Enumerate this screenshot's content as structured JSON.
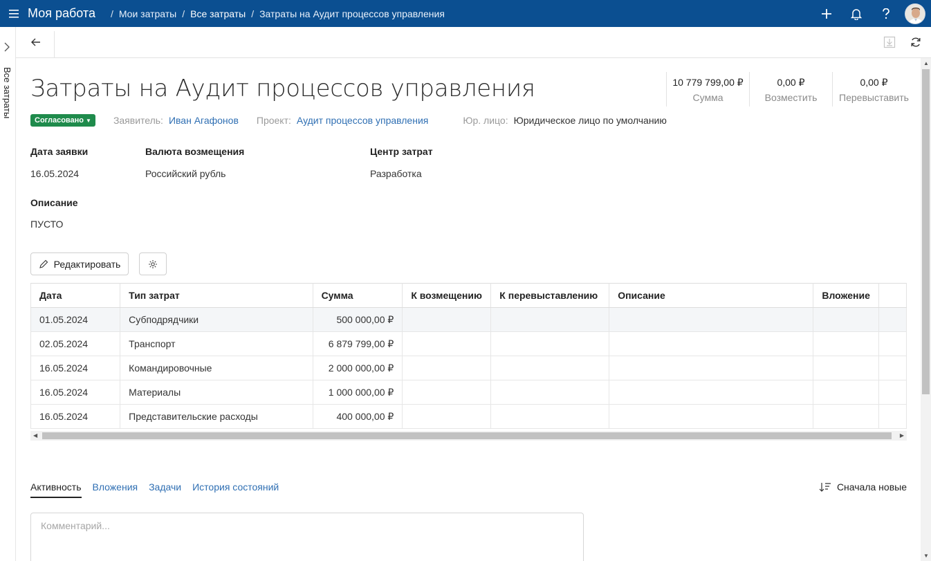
{
  "header": {
    "app_title": "Моя работа",
    "breadcrumbs": [
      {
        "label": "Мои затраты"
      },
      {
        "label": "Все затраты"
      },
      {
        "label": "Затраты на Аудит процессов управления"
      }
    ],
    "separator": "/"
  },
  "rail": {
    "label": "Все затраты"
  },
  "page": {
    "title": "Затраты на Аудит процессов управления",
    "status": "Согласовано",
    "summary": [
      {
        "value": "10 779 799,00 ₽",
        "label": "Сумма"
      },
      {
        "value": "0,00 ₽",
        "label": "Возместить"
      },
      {
        "value": "0,00 ₽",
        "label": "Перевыставить"
      }
    ],
    "meta": {
      "applicant_label": "Заявитель:",
      "applicant": "Иван Агафонов",
      "project_label": "Проект:",
      "project": "Аудит процессов управления",
      "entity_label": "Юр. лицо:",
      "entity": "Юридическое лицо по умолчанию"
    },
    "fields": {
      "date_label": "Дата заявки",
      "date_value": "16.05.2024",
      "currency_label": "Валюта возмещения",
      "currency_value": "Российский рубль",
      "cost_center_label": "Центр затрат",
      "cost_center_value": "Разработка",
      "description_label": "Описание",
      "description_value": "ПУСТО"
    },
    "edit_button": "Редактировать"
  },
  "table": {
    "columns": [
      "Дата",
      "Тип затрат",
      "Сумма",
      "К возмещению",
      "К перевыставлению",
      "Описание",
      "Вложение"
    ],
    "rows": [
      {
        "date": "01.05.2024",
        "type": "Субподрядчики",
        "amount": "500 000,00 ₽"
      },
      {
        "date": "02.05.2024",
        "type": "Транспорт",
        "amount": "6 879 799,00 ₽"
      },
      {
        "date": "16.05.2024",
        "type": "Командировочные",
        "amount": "2 000 000,00 ₽"
      },
      {
        "date": "16.05.2024",
        "type": "Материалы",
        "amount": "1 000 000,00 ₽"
      },
      {
        "date": "16.05.2024",
        "type": "Представительские расходы",
        "amount": "400 000,00 ₽"
      }
    ]
  },
  "activity": {
    "tabs": [
      "Активность",
      "Вложения",
      "Задачи",
      "История состояний"
    ],
    "sort_label": "Сначала новые",
    "comment_placeholder": "Комментарий..."
  },
  "colors": {
    "topbar": "#0b4f91",
    "status": "#1f8b4c",
    "link": "#2f6fb3"
  },
  "icons": [
    "menu-icon",
    "plus-icon",
    "bell-icon",
    "help-icon",
    "back-arrow-icon",
    "export-icon",
    "refresh-icon",
    "pencil-icon",
    "gear-icon",
    "sort-icon",
    "chevron-right-icon"
  ]
}
